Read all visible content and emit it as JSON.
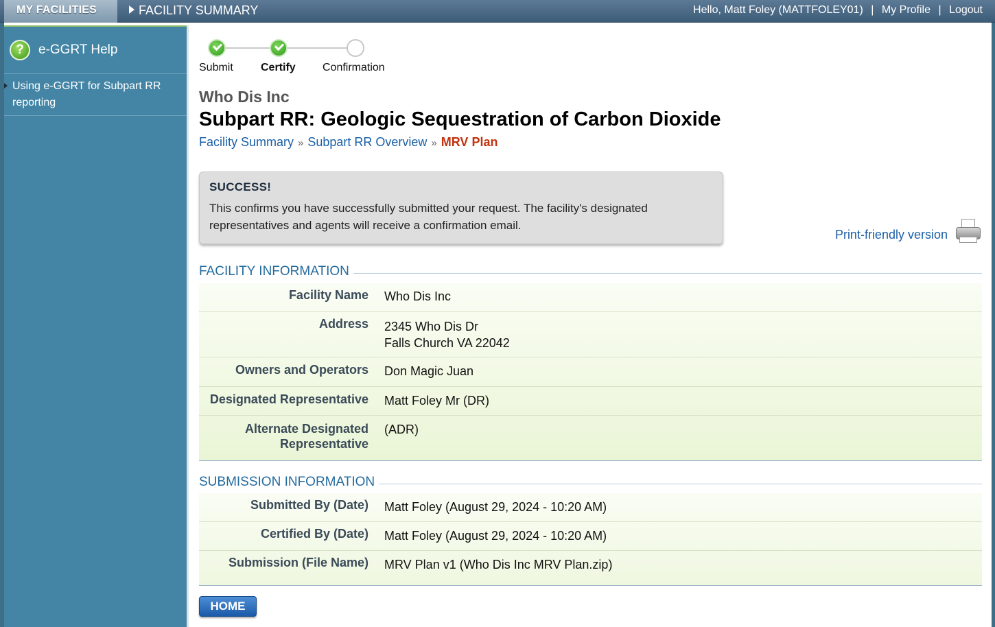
{
  "topbar": {
    "my_facilities": "MY FACILITIES",
    "facility_summary": "FACILITY SUMMARY",
    "greeting": "Hello, Matt Foley (MATTFOLEY01)",
    "my_profile": "My Profile",
    "logout": "Logout"
  },
  "sidebar": {
    "help_title": "e-GGRT Help",
    "links": [
      {
        "label": "Using e-GGRT for Subpart RR reporting"
      }
    ]
  },
  "steps": [
    {
      "label": "Submit",
      "state": "done"
    },
    {
      "label": "Certify",
      "state": "done"
    },
    {
      "label": "Confirmation",
      "state": "todo"
    }
  ],
  "header": {
    "company": "Who Dis Inc",
    "title": "Subpart RR: Geologic Sequestration of Carbon Dioxide"
  },
  "breadcrumb": {
    "items": [
      "Facility Summary",
      "Subpart RR Overview"
    ],
    "current": "MRV Plan",
    "separator": "»"
  },
  "success": {
    "heading": "SUCCESS!",
    "message": "This confirms you have successfully submitted your request. The facility's designated representatives and agents will receive a confirmation email."
  },
  "print_label": "Print-friendly version",
  "facility_info": {
    "section_title": "FACILITY INFORMATION",
    "rows": [
      {
        "label": "Facility Name",
        "value": "Who Dis Inc"
      },
      {
        "label": "Address",
        "value": "2345 Who Dis Dr",
        "value2": "Falls Church VA 22042"
      },
      {
        "label": "Owners and Operators",
        "value": "Don Magic Juan"
      },
      {
        "label": "Designated Representative",
        "value": "Matt Foley Mr (DR)"
      },
      {
        "label": "Alternate Designated Representative",
        "value": "(ADR)"
      }
    ]
  },
  "submission_info": {
    "section_title": "SUBMISSION INFORMATION",
    "rows": [
      {
        "label": "Submitted By (Date)",
        "value": "Matt Foley (August 29, 2024 - 10:20 AM)"
      },
      {
        "label": "Certified By (Date)",
        "value": "Matt Foley (August 29, 2024 - 10:20 AM)"
      },
      {
        "label": "Submission (File Name)",
        "value": "MRV Plan v1 (Who Dis Inc MRV Plan.zip)"
      }
    ]
  },
  "home_button": "HOME",
  "colors": {
    "topbar": "#4a6a87",
    "sidebar": "#4485a6",
    "link": "#1a5fa6",
    "breadcrumb_current": "#c1330e",
    "row_bg": "#f3f9e6"
  }
}
